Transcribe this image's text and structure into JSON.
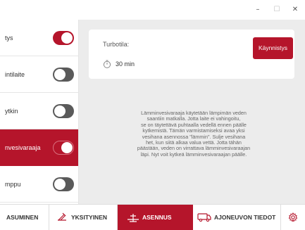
{
  "window": {
    "minimize": "–",
    "maximize": "☐",
    "close": "✕"
  },
  "sidebar": {
    "items": [
      {
        "label": "tys",
        "toggle": "on"
      },
      {
        "label": "intilaite",
        "toggle": "off"
      },
      {
        "label": "ytkin",
        "toggle": "off"
      },
      {
        "label": "nvesivaraaja",
        "toggle": "on",
        "active": true
      },
      {
        "label": "mppu",
        "toggle": "off"
      }
    ]
  },
  "turbo": {
    "caption": "Turbotila:",
    "duration": "30 min",
    "start_label": "Käynnistys",
    "timer_icon": "timer-icon"
  },
  "description_lines": [
    "Lämminvesivaraaja käytetään lämpimän veden",
    "saantiin matkalla. Jotta laite ei vahingoitu,",
    "se on täytettävä puhtaalla vedellä ennen päälle",
    "kytkemistä. Tämän varmistamiseksi avaa yksi",
    "vesihana asennossa \"lämmin\". Sulje vesihana",
    "het, kun siitä alkaa valua vettä. Jotta tähän",
    "päästään, veden on virrattava lämminvesivaraajan",
    "läpi. Nyt voit kytkeä lämminvesivaraajan päälle."
  ],
  "tabs": [
    {
      "label": "ASUMINEN",
      "icon": "home-icon"
    },
    {
      "label": "YKSITYINEN",
      "icon": "private-icon"
    },
    {
      "label": "ASENNUS",
      "icon": "settings-sliders-icon",
      "active": true
    },
    {
      "label": "AJONEUVON TIEDOT",
      "icon": "vehicle-icon"
    },
    {
      "label": "",
      "icon": "gear-icon"
    }
  ],
  "colors": {
    "accent": "#b5152b",
    "toggle_off": "#5a5a5a",
    "main_bg": "#ececec"
  }
}
